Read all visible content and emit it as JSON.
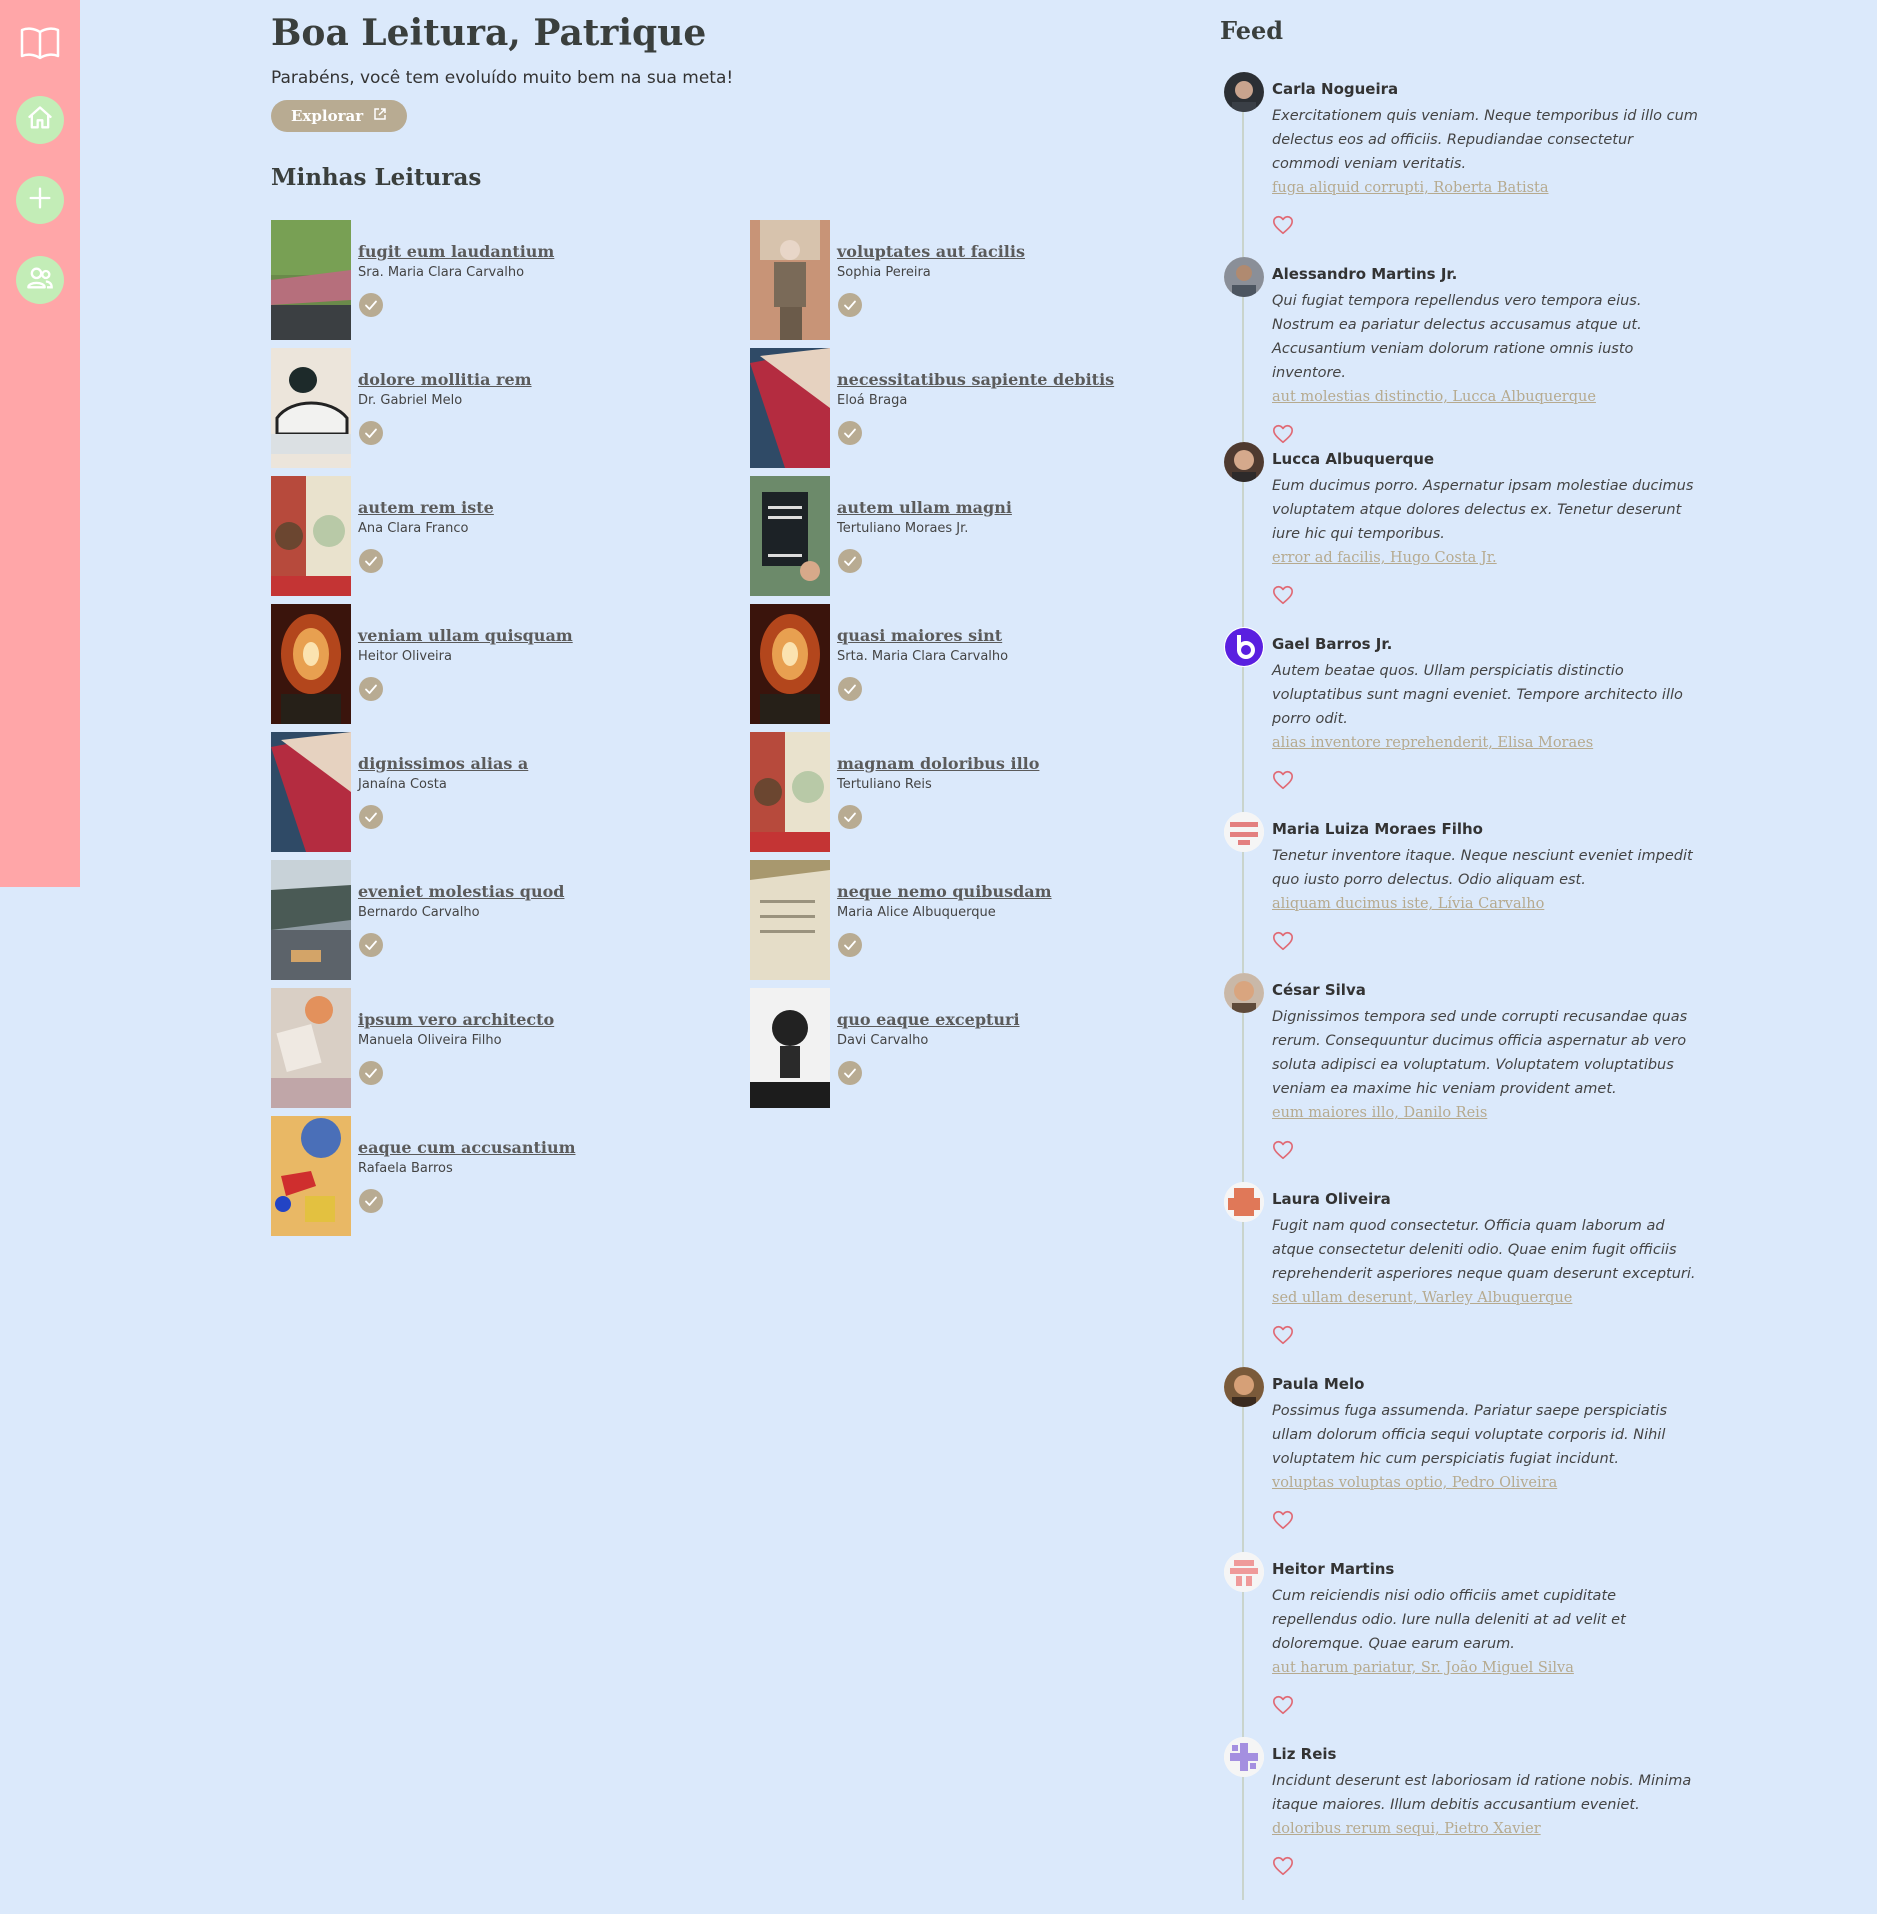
{
  "header": {
    "greeting": "Boa Leitura, Patrique",
    "subtitle": "Parabéns, você tem evoluído muito bem na sua meta!",
    "explore_label": "Explorar"
  },
  "sidebar": {
    "items": [
      {
        "name": "home-icon"
      },
      {
        "name": "plus-icon"
      },
      {
        "name": "users-icon"
      }
    ]
  },
  "readings": {
    "title": "Minhas Leituras",
    "books": [
      {
        "title": "fugit eum laudantium",
        "author": "Sra. Maria Clara Carvalho"
      },
      {
        "title": "voluptates aut facilis",
        "author": "Sophia Pereira"
      },
      {
        "title": "dolore mollitia rem",
        "author": "Dr. Gabriel Melo"
      },
      {
        "title": "necessitatibus sapiente debitis",
        "author": "Eloá Braga"
      },
      {
        "title": "autem rem iste",
        "author": "Ana Clara Franco"
      },
      {
        "title": "autem ullam magni",
        "author": "Tertuliano Moraes Jr."
      },
      {
        "title": "veniam ullam quisquam",
        "author": "Heitor Oliveira"
      },
      {
        "title": "quasi maiores sint",
        "author": "Srta. Maria Clara Carvalho"
      },
      {
        "title": "dignissimos alias a",
        "author": "Janaína Costa"
      },
      {
        "title": "magnam doloribus illo",
        "author": "Tertuliano Reis"
      },
      {
        "title": "eveniet molestias quod",
        "author": "Bernardo Carvalho"
      },
      {
        "title": "neque nemo quibusdam",
        "author": "Maria Alice Albuquerque"
      },
      {
        "title": "ipsum vero architecto",
        "author": "Manuela Oliveira Filho"
      },
      {
        "title": "quo eaque excepturi",
        "author": "Davi Carvalho"
      },
      {
        "title": "eaque cum accusantium",
        "author": "Rafaela Barros"
      }
    ]
  },
  "feed": {
    "title": "Feed",
    "posts": [
      {
        "user": "Carla Nogueira",
        "text": "Exercitationem quis veniam. Neque temporibus id illo cum delectus eos ad officiis. Repudiandae consectetur commodi veniam veritatis.",
        "link": "fuga aliquid corrupti, Roberta Batista"
      },
      {
        "user": "Alessandro Martins Jr.",
        "text": "Qui fugiat tempora repellendus vero tempora eius. Nostrum ea pariatur delectus accusamus atque ut. Accusantium veniam dolorum ratione omnis iusto inventore.",
        "link": "aut molestias distinctio, Lucca Albuquerque"
      },
      {
        "user": "Lucca Albuquerque",
        "text": "Eum ducimus porro. Aspernatur ipsam molestiae ducimus voluptatem atque dolores delectus ex. Tenetur deserunt iure hic qui temporibus.",
        "link": "error ad facilis, Hugo Costa Jr."
      },
      {
        "user": "Gael Barros Jr.",
        "text": "Autem beatae quos. Ullam perspiciatis distinctio voluptatibus sunt magni eveniet. Tempore architecto illo porro odit.",
        "link": "alias inventore reprehenderit, Elisa Moraes"
      },
      {
        "user": "Maria Luiza Moraes Filho",
        "text": "Tenetur inventore itaque. Neque nesciunt eveniet impedit quo iusto porro delectus. Odio aliquam est.",
        "link": "aliquam ducimus iste, Lívia Carvalho"
      },
      {
        "user": "César Silva",
        "text": "Dignissimos tempora sed unde corrupti recusandae quas rerum. Consequuntur ducimus officia aspernatur ab vero soluta adipisci ea voluptatum. Voluptatem voluptatibus veniam ea maxime hic veniam provident amet.",
        "link": "eum maiores illo, Danilo Reis"
      },
      {
        "user": "Laura Oliveira",
        "text": "Fugit nam quod consectetur. Officia quam laborum ad atque consectetur deleniti odio. Quae enim fugit officiis reprehenderit asperiores neque quam deserunt excepturi.",
        "link": "sed ullam deserunt, Warley Albuquerque"
      },
      {
        "user": "Paula Melo",
        "text": "Possimus fuga assumenda. Pariatur saepe perspiciatis ullam dolorum officia sequi voluptate corporis id. Nihil voluptatem hic cum perspiciatis fugiat incidunt.",
        "link": "voluptas voluptas optio, Pedro Oliveira"
      },
      {
        "user": "Heitor Martins",
        "text": "Cum reiciendis nisi odio officiis amet cupiditate repellendus odio. Iure nulla deleniti at ad velit et doloremque. Quae earum earum.",
        "link": "aut harum pariatur, Sr. João Miguel Silva"
      },
      {
        "user": "Liz Reis",
        "text": "Incidunt deserunt est laboriosam id ratione nobis. Minima itaque maiores. Illum debitis accusantium eveniet.",
        "link": "doloribus rerum sequi, Pietro Xavier"
      }
    ]
  },
  "colors": {
    "background": "#dbe9fb",
    "sidebar": "#ffa6a8",
    "nav_button": "#c3edb7",
    "accent": "#b8ab92",
    "link": "#b6aa8f",
    "heart": "#e06a75"
  }
}
